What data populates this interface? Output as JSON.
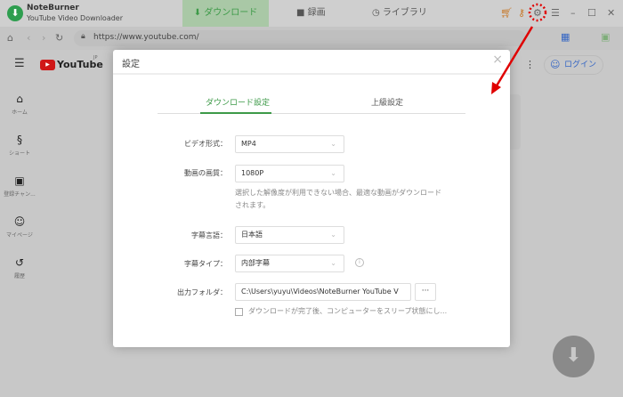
{
  "app": {
    "name": "NoteBurner",
    "subtitle": "YouTube Video Downloader"
  },
  "nav": {
    "tabs": [
      {
        "label": "ダウンロード",
        "active": true
      },
      {
        "label": "録画"
      },
      {
        "label": "ライブラリ"
      }
    ]
  },
  "browser": {
    "url": "https://www.youtube.com/"
  },
  "youtube": {
    "logo": "YouTube",
    "region": "JP",
    "login": "ログイン",
    "sidebar": [
      {
        "label": "ホーム",
        "icon": "home-icon"
      },
      {
        "label": "ショート",
        "icon": "shorts-icon"
      },
      {
        "label": "登録チャン...",
        "icon": "subscriptions-icon"
      },
      {
        "label": "マイページ",
        "icon": "account-icon"
      },
      {
        "label": "履歴",
        "icon": "history-icon"
      }
    ]
  },
  "dialog": {
    "title": "設定",
    "tabs": [
      {
        "label": "ダウンロード設定",
        "active": true
      },
      {
        "label": "上級設定"
      }
    ],
    "video_format": {
      "label": "ビデオ形式：",
      "value": "MP4"
    },
    "quality": {
      "label": "動画の画質：",
      "value": "1080P",
      "hint1": "選択した解像度が利用できない場合、最適な動画がダウンロード",
      "hint2": "されます。"
    },
    "subtitle_lang": {
      "label": "字幕言語：",
      "value": "日本語"
    },
    "subtitle_type": {
      "label": "字幕タイプ：",
      "value": "内部字幕"
    },
    "output": {
      "label": "出力フォルダ：",
      "value": "C:\\Users\\yuyu\\Videos\\NoteBurner YouTube V",
      "browse": "···"
    },
    "sleep": {
      "label": "ダウンロードが完了後、コンピューターをスリープ状態にし...",
      "checked": false
    }
  },
  "colors": {
    "accent": "#3d9a48",
    "annotation": "#e00000"
  }
}
